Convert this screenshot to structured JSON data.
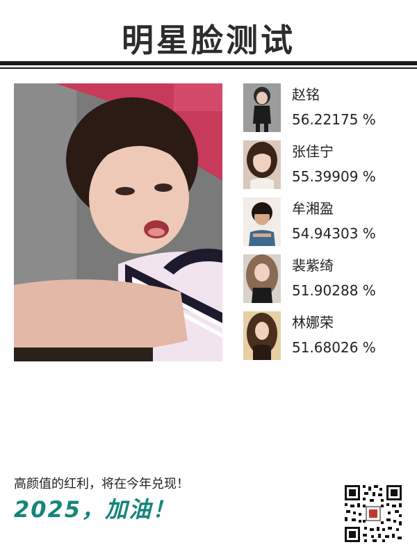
{
  "header": {
    "title": "明星脸测试"
  },
  "matches": [
    {
      "name": "赵铭",
      "score": "56.22175 %"
    },
    {
      "name": "张佳宁",
      "score": "55.39909 %"
    },
    {
      "name": "牟湘盈",
      "score": "54.94303 %"
    },
    {
      "name": "裴紫绮",
      "score": "51.90288 %"
    },
    {
      "name": "林娜荣",
      "score": "51.68026 %"
    }
  ],
  "footer": {
    "slogan": "高颜值的红利，将在今年兑现！",
    "cheer": "2025，加油！"
  },
  "colors": {
    "accent": "#16857a",
    "title": "#2c2c2c",
    "rule": "#1a1a1a"
  }
}
